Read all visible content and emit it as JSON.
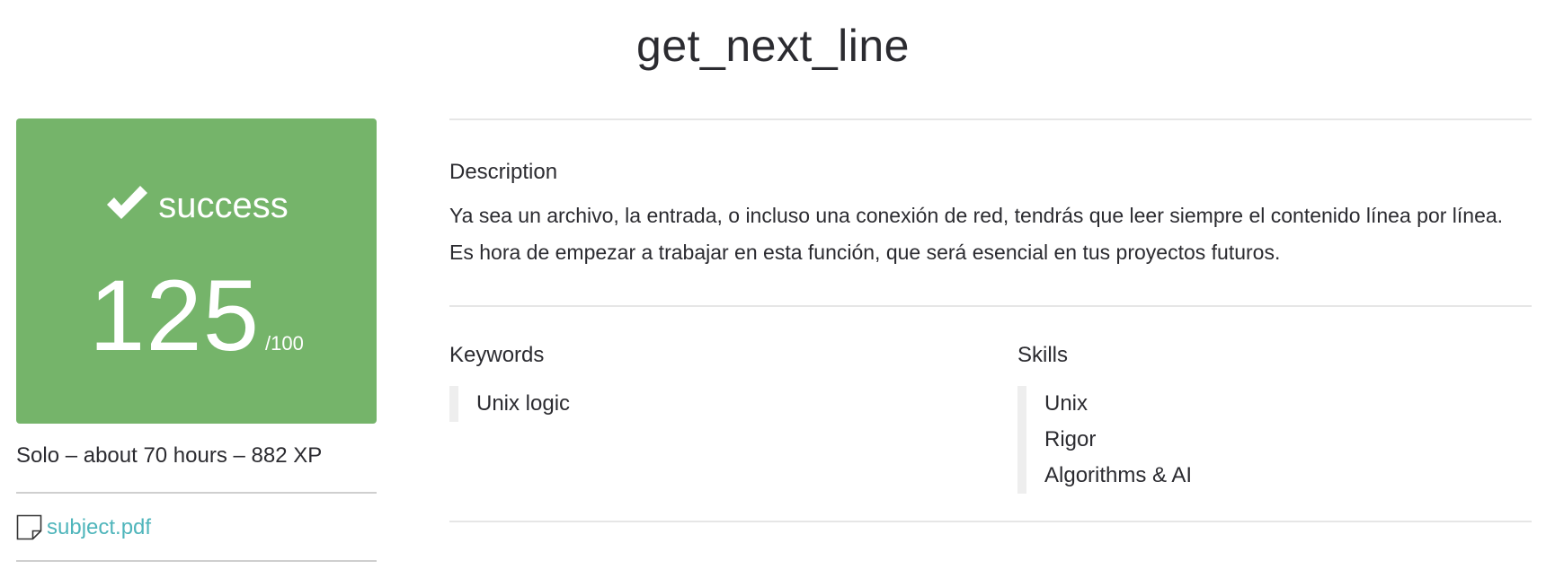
{
  "title": "get_next_line",
  "result": {
    "status_label": "success",
    "score": "125",
    "score_max": "/100",
    "color": "#75b46a",
    "icon": "check-icon"
  },
  "meta": "Solo – about 70 hours – 882 XP",
  "attachment": {
    "icon": "document-icon",
    "label": "subject.pdf"
  },
  "description": {
    "heading": "Description",
    "text": "Ya sea un archivo, la entrada, o incluso una conexión de red, tendrás que leer siempre el contenido línea por línea. Es hora de empezar a trabajar en esta función, que será esencial en tus proyectos futuros."
  },
  "keywords": {
    "heading": "Keywords",
    "items": [
      "Unix logic"
    ]
  },
  "skills": {
    "heading": "Skills",
    "items": [
      "Unix",
      "Rigor",
      "Algorithms & AI"
    ]
  }
}
